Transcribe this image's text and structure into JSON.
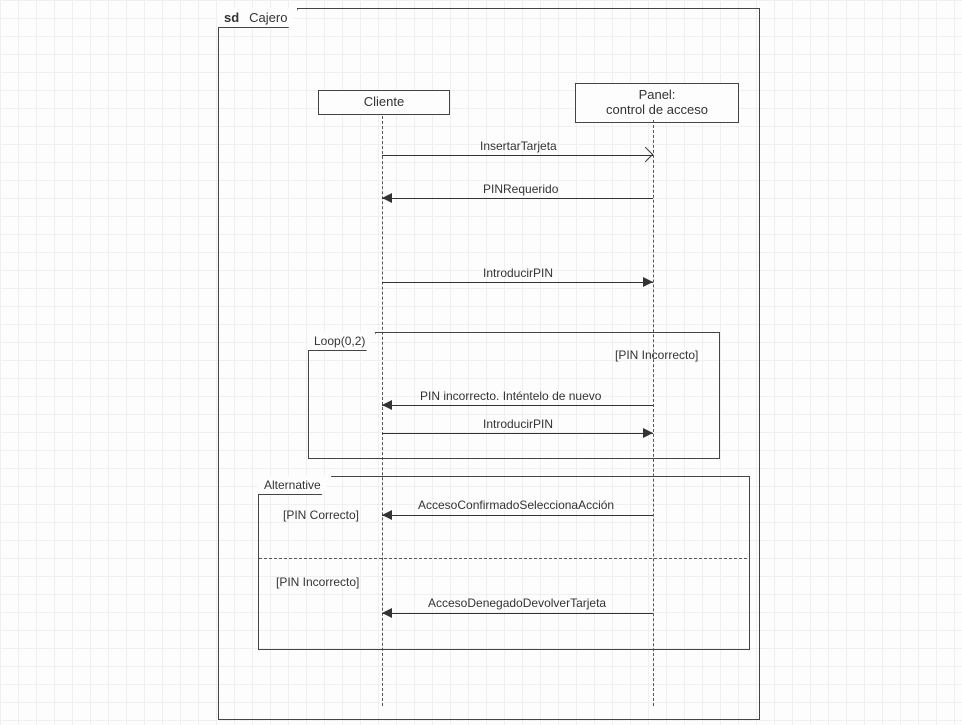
{
  "diagram": {
    "kind": "UML sequence diagram",
    "frame_prefix": "sd",
    "frame_name": "Cajero",
    "participants": {
      "p1": "Cliente",
      "p2_line1": "Panel:",
      "p2_line2": "control de acceso"
    },
    "messages": {
      "m1": "InsertarTarjeta",
      "m2": "PINRequerido",
      "m3": "IntroducirPIN",
      "m4": "PIN incorrecto. Inténtelo de nuevo",
      "m5": "IntroducirPIN",
      "m6": "AccesoConfirmadoSeleccionaAcción",
      "m7": "AccesoDenegadoDevolverTarjeta"
    },
    "fragments": {
      "loop_operator": "Loop(0,2)",
      "loop_guard": "[PIN Incorrecto]",
      "alt_operator": "Alternative",
      "alt_guard1": "[PIN Correcto]",
      "alt_guard2": "[PIN Incorrecto]"
    }
  }
}
